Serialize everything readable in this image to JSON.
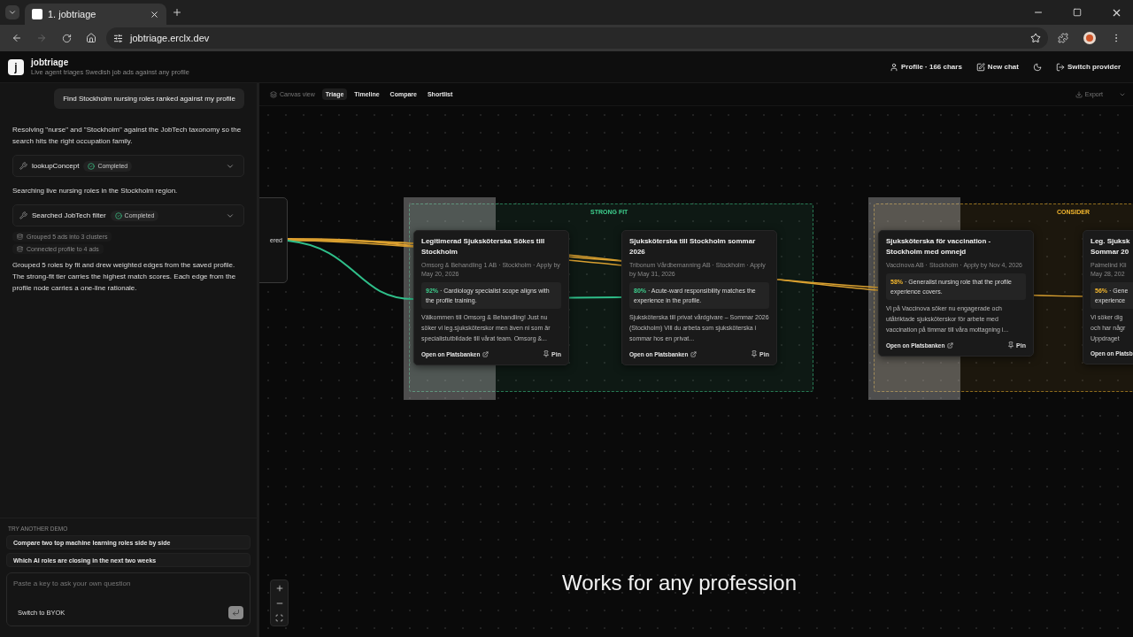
{
  "browser": {
    "tabs": [
      {
        "title": "1. jobtriage",
        "selected": true
      }
    ],
    "url": "jobtriage.erclx.dev"
  },
  "app": {
    "logo": "j",
    "title": "jobtriage",
    "subtitle": "Live agent triages Swedish job ads against any profile",
    "actions": [
      "Profile · 166 chars",
      "New chat",
      "Switch provider"
    ]
  },
  "chat": {
    "user_message": "Find Stockholm nursing roles ranked against my profile",
    "steps": [
      {
        "kind": "text",
        "text": "Resolving \"nurse\" and \"Stockholm\" against the JobTech taxonomy so the search hits the right occupation family."
      },
      {
        "kind": "tool",
        "text": "lookupConcept",
        "status": "Completed"
      },
      {
        "kind": "text",
        "text": "Searching live nursing roles in the Stockholm region."
      },
      {
        "kind": "tool",
        "text": "Searched JobTech filter",
        "status": "Completed"
      },
      {
        "kind": "note",
        "text": "Grouped 5 ads into 3 clusters"
      },
      {
        "kind": "note",
        "text": "Connected profile to 4 ads"
      },
      {
        "kind": "text",
        "text": "Grouped 5 roles by fit and drew weighted edges from the saved profile. The strong-fit tier carries the highest match scores. Each edge from the profile node carries a one-line rationale."
      }
    ]
  },
  "demos": {
    "heading": "TRY ANOTHER DEMO",
    "prompts": [
      "Compare two top machine learning roles side by side",
      "Which AI roles are closing in the next two weeks"
    ],
    "input_placeholder": "Paste a key to ask your own question",
    "byok_button": "Switch to BYOK"
  },
  "canvas": {
    "views": [
      {
        "label": "Canvas view",
        "selected": false
      },
      {
        "label": "Triage",
        "selected": true
      },
      {
        "label": "Timeline",
        "selected": false
      },
      {
        "label": "Compare",
        "selected": false
      },
      {
        "label": "Shortlist",
        "selected": false
      }
    ],
    "export": "Export",
    "profile_node": "ered",
    "groups": [
      {
        "label": "STRONG FIT",
        "color": "#3ecf8e",
        "cards": [
          {
            "title": "Legitimerad Sjuksköterska Sökes till Stockholm",
            "meta": "Omsorg & Behandling 1 AB · Stockholm · Apply by May 20, 2026",
            "score": "92%",
            "rationale": "· Cardiology specialist scope aligns with the profile training.",
            "excerpt": "Välkommen till Omsorg & Behandling! Just nu söker vi leg.sjuksköterskor men även ni som är specialistutbildade till vårat team. Omsorg &...",
            "link": "Open on Platsbanken",
            "pin": "Pin"
          },
          {
            "title": "Sjuksköterska till Stockholm sommar 2026",
            "meta": "Tribonum Vårdbemanning AB · Stockholm · Apply by May 31, 2026",
            "score": "80%",
            "rationale": "· Acute-ward responsibility matches the experience in the profile.",
            "excerpt": "Sjuksköterska till privat vårdgivare – Sommar 2026 (Stockholm) Vill du arbeta som sjuksköterska i sommar hos en privat...",
            "link": "Open on Platsbanken",
            "pin": "Pin"
          }
        ]
      },
      {
        "label": "CONSIDER",
        "color": "#f5b82e",
        "cards": [
          {
            "title": "Sjuksköterska för vaccination - Stockholm med omnejd",
            "meta": "Vaccinova AB · Stockholm · Apply by Nov 4, 2026",
            "score": "58%",
            "rationale": "· Generalist nursing role that the profile experience covers.",
            "excerpt": "Vi på Vaccinova söker nu engagerade och utåtriktade sjuksköterskor för arbete med vaccination på timmar till våra mottagning i...",
            "link": "Open on Platsbanken",
            "pin": "Pin"
          },
          {
            "title": "Leg. Sjuksk\nSommar 20",
            "meta": "Palmelind Kli\nMay 28, 202",
            "score": "56%",
            "rationale": "· Gene\nexperience",
            "excerpt": "Vi söker dig\noch har någr\nUppdraget",
            "link": "Open on Platsb"
          }
        ]
      }
    ]
  },
  "caption": "Works for any profession"
}
